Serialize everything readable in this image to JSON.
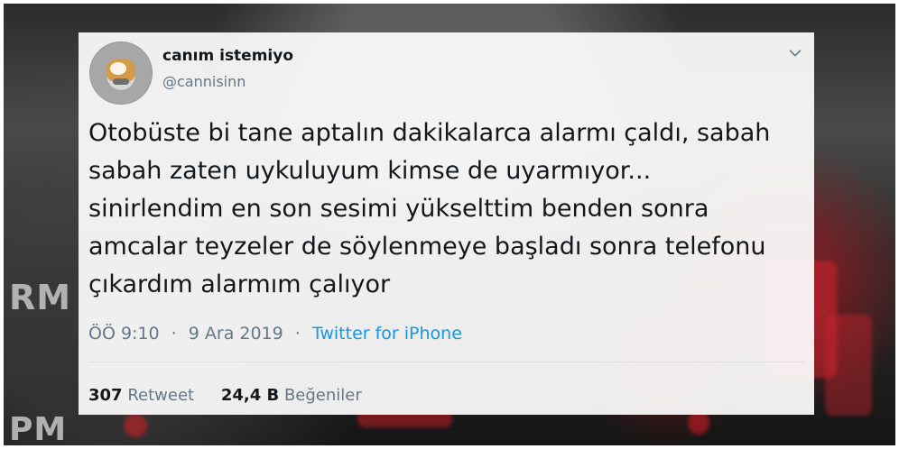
{
  "background": {
    "text_left_top": "RM",
    "text_left_bottom": "PM"
  },
  "tweet": {
    "name": "canım istemiyo",
    "handle": "@cannisinn",
    "text": "Otobüste bi tane aptalın dakikalarca alarmı çaldı, sabah\nsabah zaten uykuluyum kimse de uyarmıyor...\nsinirlendim en son sesimi yükselttim benden sonra\namcalar teyzeler de söylenmeye başladı sonra telefonu\nçıkardım alarmım çalıyor",
    "time": "ÖÖ 9:10",
    "separator": "·",
    "date": "9 Ara 2019",
    "source": "Twitter for iPhone",
    "retweet_count": "307",
    "retweet_label": "Retweet",
    "likes_count": "24,4 B",
    "likes_label": "Beğeniler"
  },
  "icons": {
    "chevron": "chevron-down-icon"
  },
  "colors": {
    "text_primary": "#14171a",
    "text_secondary": "#657786",
    "link": "#1b95e0",
    "card_background": "#ffffff"
  }
}
